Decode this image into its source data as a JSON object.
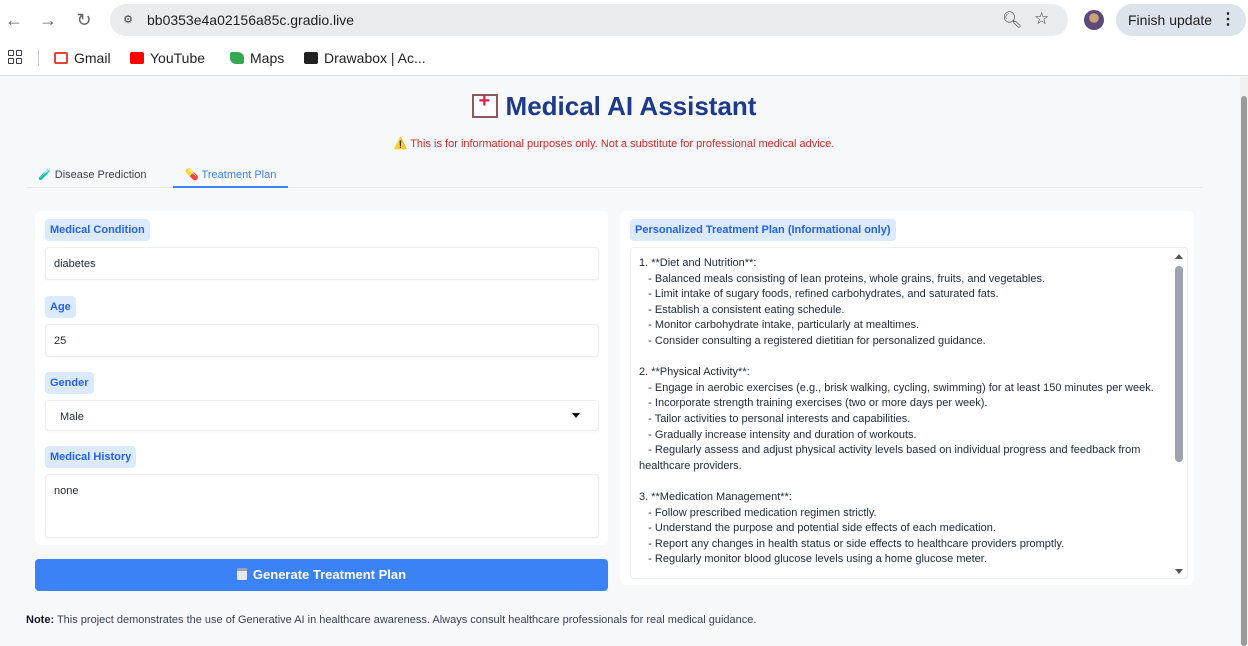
{
  "browser": {
    "url": "bb0353e4a02156a85c.gradio.live",
    "finish_update_label": "Finish update",
    "bookmarks": [
      {
        "label": "Gmail",
        "color": "#ea4335"
      },
      {
        "label": "YouTube",
        "color": "#ff0000"
      },
      {
        "label": "Maps",
        "color": "#34a853"
      },
      {
        "label": "Drawabox | Ac...",
        "color": "#222222"
      }
    ]
  },
  "app": {
    "title": "Medical AI Assistant",
    "disclaimer": "⚠️ This is for informational purposes only. Not a substitute for professional medical advice.",
    "tabs": [
      {
        "label": "🧪 Disease Prediction",
        "active": false
      },
      {
        "label": "💊 Treatment Plan",
        "active": true
      }
    ]
  },
  "form": {
    "condition_label": "Medical Condition",
    "condition_value": "diabetes",
    "age_label": "Age",
    "age_value": "25",
    "gender_label": "Gender",
    "gender_value": "Male",
    "history_label": "Medical History",
    "history_value": "none",
    "generate_button": "Generate Treatment Plan"
  },
  "output": {
    "label": "Personalized Treatment Plan (Informational only)",
    "text": "1. **Diet and Nutrition**:\n   - Balanced meals consisting of lean proteins, whole grains, fruits, and vegetables.\n   - Limit intake of sugary foods, refined carbohydrates, and saturated fats.\n   - Establish a consistent eating schedule.\n   - Monitor carbohydrate intake, particularly at mealtimes.\n   - Consider consulting a registered dietitian for personalized guidance.\n\n2. **Physical Activity**:\n   - Engage in aerobic exercises (e.g., brisk walking, cycling, swimming) for at least 150 minutes per week.\n   - Incorporate strength training exercises (two or more days per week).\n   - Tailor activities to personal interests and capabilities.\n   - Gradually increase intensity and duration of workouts.\n   - Regularly assess and adjust physical activity levels based on individual progress and feedback from healthcare providers.\n\n3. **Medication Management**:\n   - Follow prescribed medication regimen strictly.\n   - Understand the purpose and potential side effects of each medication.\n   - Report any changes in health status or side effects to healthcare providers promptly.\n   - Regularly monitor blood glucose levels using a home glucose meter."
  },
  "footer": {
    "note_label": "Note:",
    "note_text": " This project demonstrates the use of Generative AI in healthcare awareness. Always consult healthcare professionals for real medical guidance."
  }
}
